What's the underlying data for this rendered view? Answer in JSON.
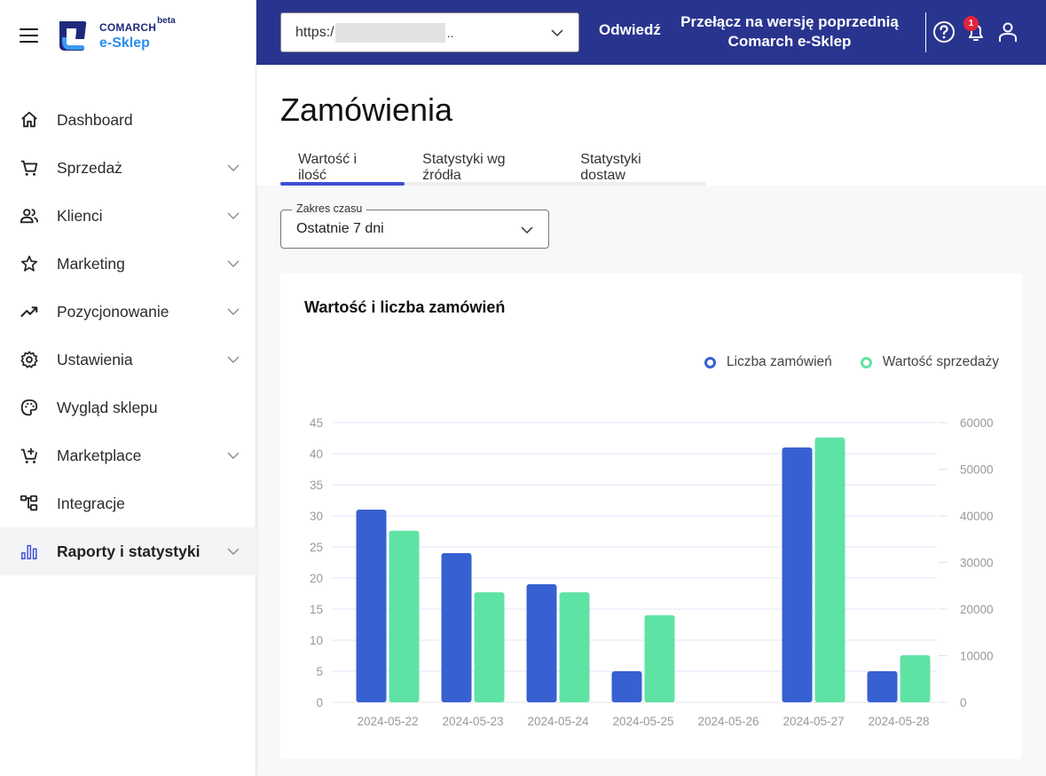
{
  "app": {
    "brand": "COMARCH",
    "beta": "beta",
    "product": "e-Sklep"
  },
  "sidebar": {
    "items": [
      {
        "id": "dashboard",
        "label": "Dashboard",
        "icon": "home-icon",
        "expandable": false,
        "active": false
      },
      {
        "id": "sprzedaz",
        "label": "Sprzedaż",
        "icon": "cart-icon",
        "expandable": true,
        "active": false
      },
      {
        "id": "klienci",
        "label": "Klienci",
        "icon": "users-icon",
        "expandable": true,
        "active": false
      },
      {
        "id": "marketing",
        "label": "Marketing",
        "icon": "star-icon",
        "expandable": true,
        "active": false
      },
      {
        "id": "pozycjonowanie",
        "label": "Pozycjonowanie",
        "icon": "trending-up-icon",
        "expandable": true,
        "active": false
      },
      {
        "id": "ustawienia",
        "label": "Ustawienia",
        "icon": "gear-icon",
        "expandable": true,
        "active": false
      },
      {
        "id": "wyglad",
        "label": "Wygląd sklepu",
        "icon": "palette-icon",
        "expandable": false,
        "active": false
      },
      {
        "id": "marketplace",
        "label": "Marketplace",
        "icon": "cart-plus-icon",
        "expandable": true,
        "active": false
      },
      {
        "id": "integracje",
        "label": "Integracje",
        "icon": "flow-icon",
        "expandable": false,
        "active": false
      },
      {
        "id": "raporty",
        "label": "Raporty i statystyki",
        "icon": "bar-chart-icon",
        "expandable": true,
        "active": true
      }
    ]
  },
  "topbar": {
    "url_prefix": "https:/",
    "url_ellipsis": "..",
    "visit_label": "Odwiedź",
    "switch_line1": "Przełącz na wersję poprzednią",
    "switch_line2": "Comarch e-Sklep",
    "notifications_count": "1"
  },
  "page": {
    "title": "Zamówienia",
    "tabs": [
      {
        "label": "Wartość i ilość",
        "active": true
      },
      {
        "label": "Statystyki wg źródła",
        "active": false
      },
      {
        "label": "Statystyki dostaw",
        "active": false
      }
    ],
    "range": {
      "label": "Zakres czasu",
      "value": "Ostatnie 7 dni"
    }
  },
  "colors": {
    "accent": "#3d4fd6",
    "topbar": "#29348f",
    "series_orders": "#3760d1",
    "series_sales": "#5fe3a5",
    "badge": "#e3243b"
  },
  "chart_data": {
    "type": "bar",
    "title": "Wartość i liczba zamówień",
    "categories": [
      "2024-05-22",
      "2024-05-23",
      "2024-05-24",
      "2024-05-25",
      "2024-05-26",
      "2024-05-27",
      "2024-05-28"
    ],
    "series": [
      {
        "name": "Liczba zamówień",
        "axis": "left",
        "color": "#3760d1",
        "values": [
          31,
          24,
          19,
          5,
          0,
          41,
          5
        ]
      },
      {
        "name": "Wartość sprzedaży",
        "axis": "right",
        "color": "#5fe3a5",
        "values": [
          36800,
          23600,
          23600,
          18700,
          0,
          56800,
          10100
        ]
      }
    ],
    "y_left": {
      "min": 0,
      "max": 45,
      "ticks": [
        0,
        5,
        10,
        15,
        20,
        25,
        30,
        35,
        40,
        45
      ]
    },
    "y_right": {
      "min": 0,
      "max": 60000,
      "ticks": [
        0,
        10000,
        20000,
        30000,
        40000,
        50000,
        60000
      ]
    },
    "xlabel": "",
    "ylabel": "",
    "grid": true,
    "legend_position": "top-right"
  }
}
